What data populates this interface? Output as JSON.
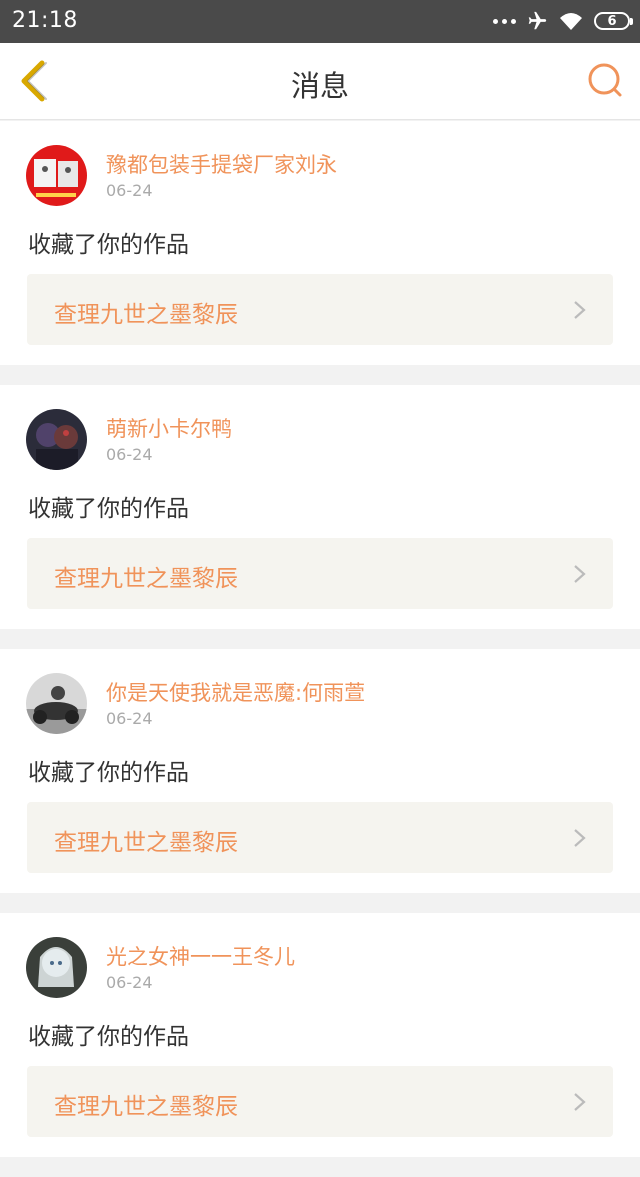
{
  "status_bar": {
    "time": "21:18",
    "battery": "6",
    "icons": [
      "more-dots-icon",
      "airplane-icon",
      "wifi-icon",
      "battery-icon"
    ]
  },
  "header": {
    "title": "消息",
    "back_icon": "back-chevron-icon",
    "search_icon": "search-icon"
  },
  "colors": {
    "accent": "#f0935a",
    "back_icon": "#d9a800",
    "status_bar": "#4a4a4a",
    "work_bg": "#f5f4ef"
  },
  "messages": [
    {
      "name": "豫都包装手提袋厂家刘永",
      "date": "06-24",
      "action": "收藏了你的作品",
      "work_title": "查理九世之墨黎辰",
      "avatar": "avatar-red"
    },
    {
      "name": "萌新小卡尔鸭",
      "date": "06-24",
      "action": "收藏了你的作品",
      "work_title": "查理九世之墨黎辰",
      "avatar": "avatar-dark"
    },
    {
      "name": "你是天使我就是恶魔:何雨萱",
      "date": "06-24",
      "action": "收藏了你的作品",
      "work_title": "查理九世之墨黎辰",
      "avatar": "avatar-moto"
    },
    {
      "name": "光之女神一一王冬儿",
      "date": "06-24",
      "action": "收藏了你的作品",
      "work_title": "查理九世之墨黎辰",
      "avatar": "avatar-girl"
    }
  ]
}
